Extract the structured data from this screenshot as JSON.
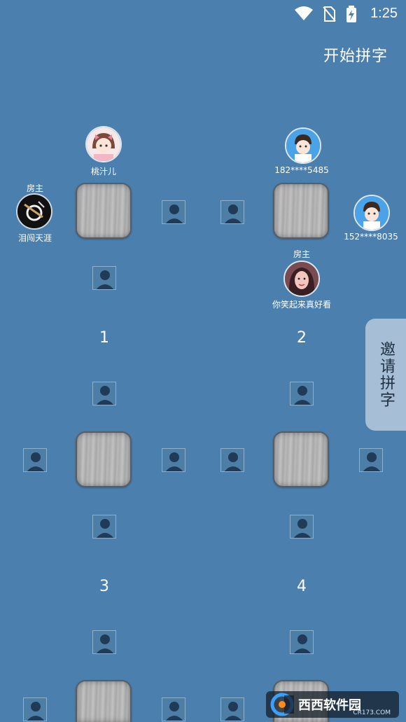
{
  "status_bar": {
    "time": "1:25",
    "icons": [
      "wifi-icon",
      "no-sim-icon",
      "battery-charging-icon"
    ]
  },
  "header": {
    "start_label": "开始拼字"
  },
  "tables": [
    {
      "number": "1"
    },
    {
      "number": "2"
    },
    {
      "number": "3"
    },
    {
      "number": "4"
    }
  ],
  "players": {
    "t1_top": {
      "name": "桃汁儿"
    },
    "t1_left": {
      "name": "泪闯天涯",
      "role": "房主"
    },
    "t2_top": {
      "name": "182****5485"
    },
    "t2_right": {
      "name": "152****8035"
    },
    "t2_bottom": {
      "name": "你笑起来真好看",
      "role": "房主"
    }
  },
  "invite": {
    "label": "邀请拼字"
  },
  "watermark": {
    "text": "西西软件园",
    "sub": "CR173.COM"
  }
}
